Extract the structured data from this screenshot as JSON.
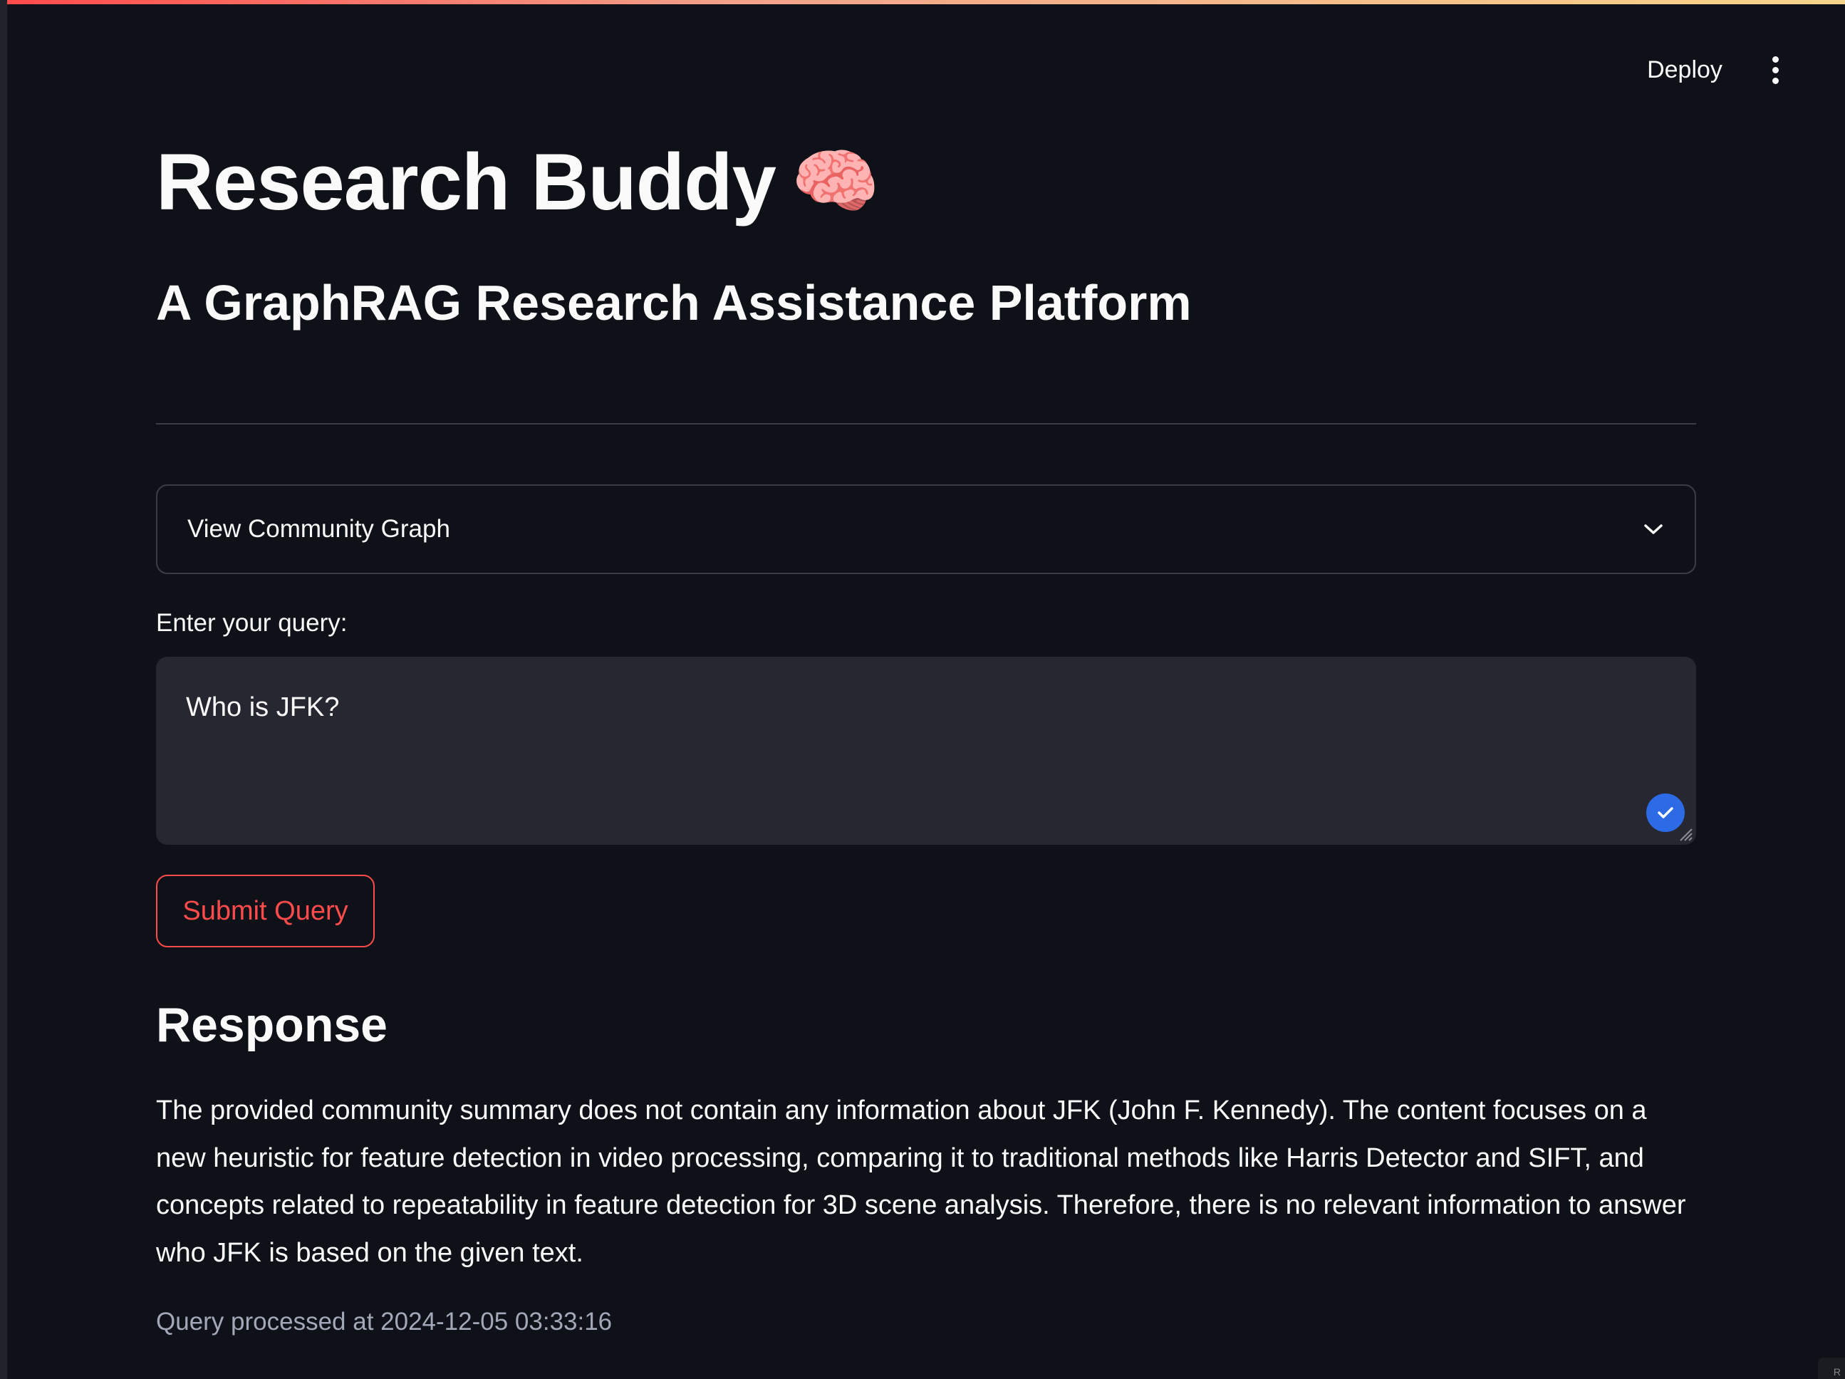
{
  "header": {
    "deploy_label": "Deploy",
    "menu_icon": "kebab-menu-icon"
  },
  "main": {
    "title": "Research Buddy",
    "title_emoji": "🧠",
    "subtitle": "A GraphRAG Research Assistance Platform",
    "expander": {
      "label": "View Community Graph",
      "icon": "chevron-down-icon"
    },
    "query": {
      "label": "Enter your query:",
      "value": "Who is JFK?"
    },
    "submit_label": "Submit Query",
    "response_heading": "Response",
    "response_text": "The provided community summary does not contain any information about JFK (John F. Kennedy). The content focuses on a new heuristic for feature detection in video processing, comparing it to traditional methods like Harris Detector and SIFT, and concepts related to repeatability in feature detection for 3D scene analysis. Therefore, there is no relevant information to answer who JFK is based on the given text.",
    "timestamp": "Query processed at 2024-12-05 03:33:16"
  },
  "corner_tag": "R",
  "colors": {
    "background": "#0e1117",
    "accent": "#ff4b4b",
    "input_bg": "#262730",
    "check_badge": "#2d6be6",
    "muted_text": "#a3a8b8"
  }
}
